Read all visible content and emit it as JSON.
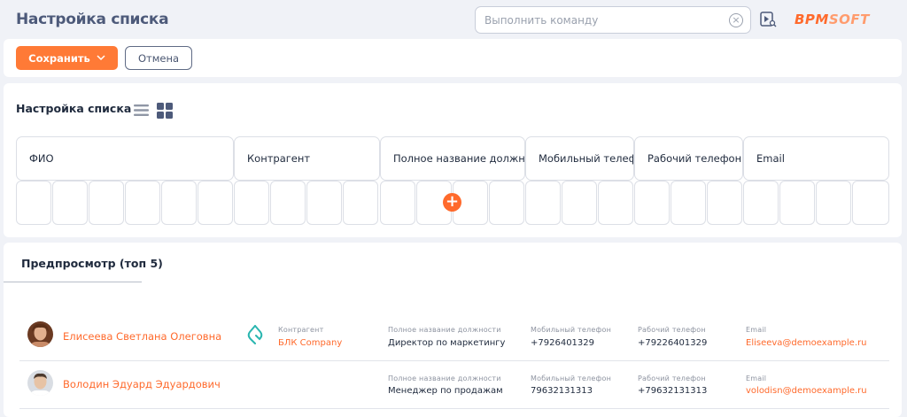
{
  "header": {
    "title": "Настройка списка",
    "search_placeholder": "Выполнить команду",
    "logo_main": "BPM",
    "logo_soft": "SOFT"
  },
  "actions": {
    "save_label": "Сохранить",
    "cancel_label": "Отмена"
  },
  "settings": {
    "title": "Настройка списка",
    "columns": [
      "ФИО",
      "Контрагент",
      "Полное название должн",
      "Мобильный телеф",
      "Рабочий телефон",
      "Email"
    ]
  },
  "preview": {
    "title": "Предпросмотр (топ 5)",
    "rows": [
      {
        "name": "Елисеева Светлана Олеговна",
        "account_label": "Контрагент",
        "account_value": "БЛК Company",
        "job_label": "Полное название должности",
        "job_value": "Директор по маркетингу",
        "mobile_label": "Мобильный телефон",
        "mobile_value": "+7926401329",
        "work_label": "Рабочий телефон",
        "work_value": "+79226401329",
        "email_label": "Email",
        "email_value": "Eliseeva@demoexample.ru"
      },
      {
        "name": "Володин Эдуард Эдуардович",
        "job_label": "Полное название должности",
        "job_value": "Менеджер по продажам",
        "mobile_label": "Мобильный телефон",
        "mobile_value": "79632131313",
        "work_label": "Рабочий телефон",
        "work_value": "+79632131313",
        "email_label": "Email",
        "email_value": "volodisn@demoexample.ru"
      }
    ]
  },
  "colors": {
    "accent": "#ff6a2c",
    "title_gray": "#4d5a7a",
    "background": "#f0f2f7"
  },
  "icons": [
    "clear-icon",
    "play-help-icon",
    "chevron-down-icon",
    "list-view-icon",
    "tile-view-icon",
    "add-icon",
    "account-logo-icon"
  ]
}
